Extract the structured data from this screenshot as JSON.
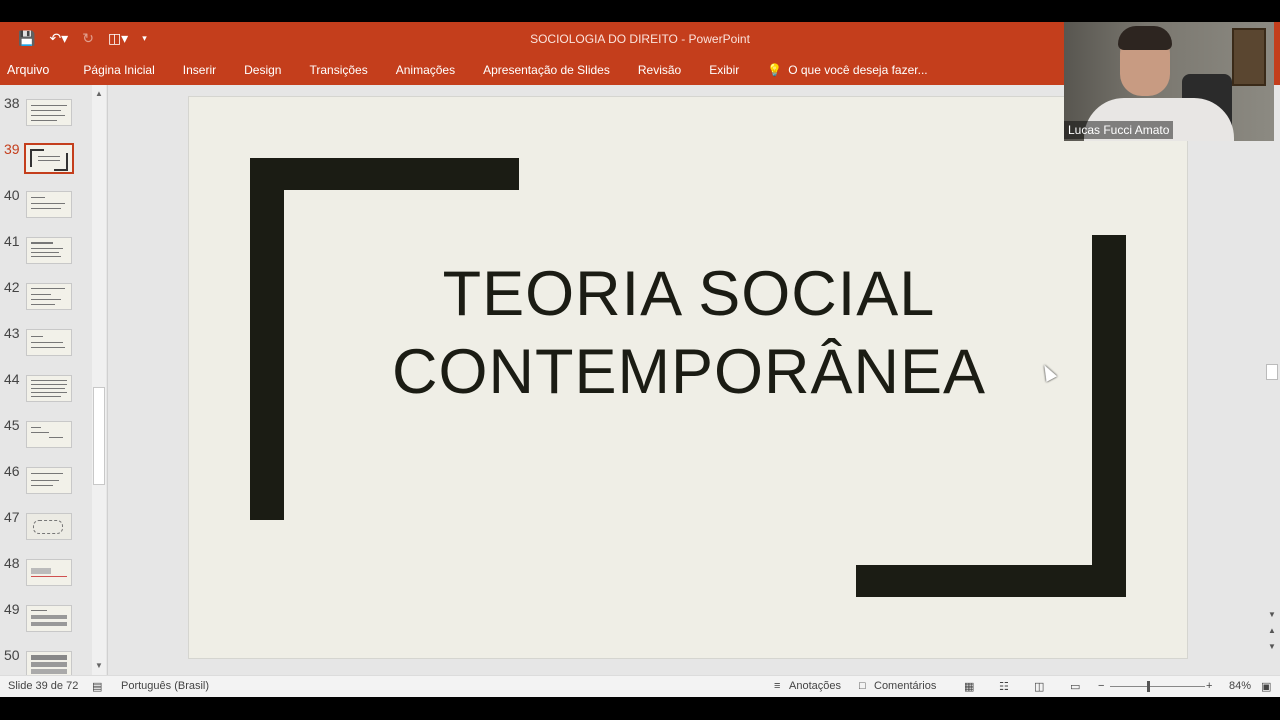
{
  "window": {
    "title": "SOCIOLOGIA DO DIREITO - PowerPoint",
    "qat_icons": [
      "save-icon",
      "undo-icon",
      "redo-icon",
      "start-from-beginning-icon",
      "customize-qat-icon"
    ]
  },
  "ribbon": {
    "tabs": [
      "Arquivo",
      "Página Inicial",
      "Inserir",
      "Design",
      "Transições",
      "Animações",
      "Apresentação de Slides",
      "Revisão",
      "Exibir"
    ],
    "tell_me": "O que você deseja fazer..."
  },
  "thumbnails": {
    "numbers": [
      "38",
      "39",
      "40",
      "41",
      "42",
      "43",
      "44",
      "45",
      "46",
      "47",
      "48",
      "49",
      "50"
    ],
    "active_number": "39"
  },
  "slide": {
    "title_line1": "TEORIA SOCIAL",
    "title_line2": "CONTEMPORÂNEA",
    "background": "#efeee6",
    "shape_color": "#1b1c14"
  },
  "status": {
    "slide_counter": "Slide 39 de 72",
    "language": "Português (Brasil)",
    "notes_label": "Anotações",
    "comments_label": "Comentários",
    "zoom_minus": "−",
    "zoom_plus": "+",
    "zoom_level": "84%"
  },
  "webcam": {
    "participant_name": "Lucas Fucci Amato"
  },
  "colors": {
    "accent": "#c43e1c"
  }
}
